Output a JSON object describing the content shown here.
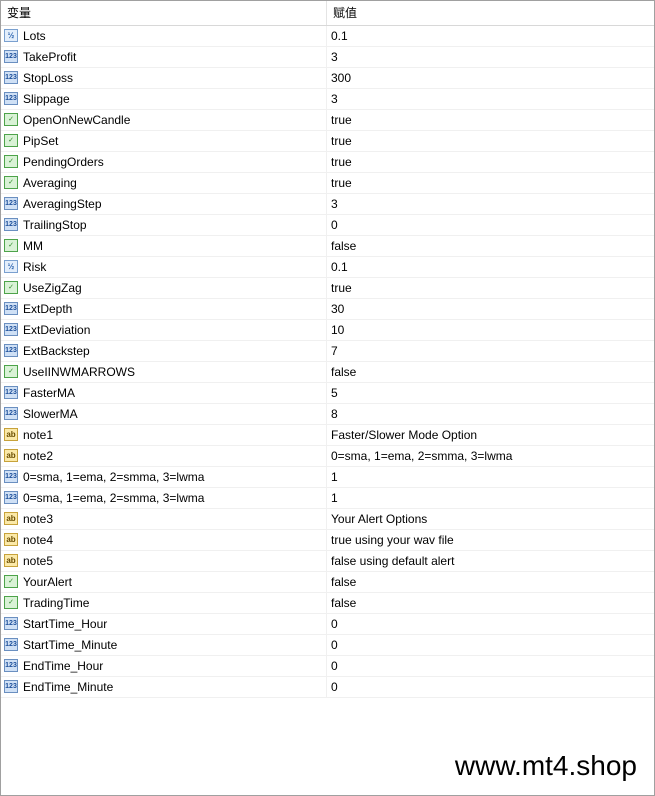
{
  "header": {
    "col_variable": "变量",
    "col_value": "赋值"
  },
  "rows": [
    {
      "name": "Lots",
      "value": "0.1",
      "type": "double",
      "icon": "double-type-icon",
      "badge": "½"
    },
    {
      "name": "TakeProfit",
      "value": "3",
      "type": "int",
      "icon": "int-type-icon",
      "badge": "123"
    },
    {
      "name": "StopLoss",
      "value": "300",
      "type": "int",
      "icon": "int-type-icon",
      "badge": "123"
    },
    {
      "name": "Slippage",
      "value": "3",
      "type": "int",
      "icon": "int-type-icon",
      "badge": "123"
    },
    {
      "name": "OpenOnNewCandle",
      "value": "true",
      "type": "bool",
      "icon": "bool-type-icon",
      "badge": "✓"
    },
    {
      "name": "PipSet",
      "value": "true",
      "type": "bool",
      "icon": "bool-type-icon",
      "badge": "✓"
    },
    {
      "name": "PendingOrders",
      "value": "true",
      "type": "bool",
      "icon": "bool-type-icon",
      "badge": "✓"
    },
    {
      "name": "Averaging",
      "value": "true",
      "type": "bool",
      "icon": "bool-type-icon",
      "badge": "✓"
    },
    {
      "name": "AveragingStep",
      "value": "3",
      "type": "int",
      "icon": "int-type-icon",
      "badge": "123"
    },
    {
      "name": "TrailingStop",
      "value": "0",
      "type": "int",
      "icon": "int-type-icon",
      "badge": "123"
    },
    {
      "name": "MM",
      "value": "false",
      "type": "bool",
      "icon": "bool-type-icon",
      "badge": "✓"
    },
    {
      "name": "Risk",
      "value": "0.1",
      "type": "double",
      "icon": "double-type-icon",
      "badge": "½"
    },
    {
      "name": "UseZigZag",
      "value": "true",
      "type": "bool",
      "icon": "bool-type-icon",
      "badge": "✓"
    },
    {
      "name": "ExtDepth",
      "value": "30",
      "type": "int",
      "icon": "int-type-icon",
      "badge": "123"
    },
    {
      "name": "ExtDeviation",
      "value": "10",
      "type": "int",
      "icon": "int-type-icon",
      "badge": "123"
    },
    {
      "name": "ExtBackstep",
      "value": "7",
      "type": "int",
      "icon": "int-type-icon",
      "badge": "123"
    },
    {
      "name": "UseIINWMARROWS",
      "value": "false",
      "type": "bool",
      "icon": "bool-type-icon",
      "badge": "✓"
    },
    {
      "name": "FasterMA",
      "value": "5",
      "type": "int",
      "icon": "int-type-icon",
      "badge": "123"
    },
    {
      "name": "SlowerMA",
      "value": "8",
      "type": "int",
      "icon": "int-type-icon",
      "badge": "123"
    },
    {
      "name": "note1",
      "value": "Faster/Slower Mode Option",
      "type": "string",
      "icon": "string-type-icon",
      "badge": "ab"
    },
    {
      "name": "note2",
      "value": "0=sma, 1=ema, 2=smma, 3=lwma",
      "type": "string",
      "icon": "string-type-icon",
      "badge": "ab"
    },
    {
      "name": "0=sma, 1=ema, 2=smma, 3=lwma",
      "value": "1",
      "type": "int",
      "icon": "int-type-icon",
      "badge": "123"
    },
    {
      "name": "0=sma, 1=ema, 2=smma, 3=lwma",
      "value": "1",
      "type": "int",
      "icon": "int-type-icon",
      "badge": "123"
    },
    {
      "name": "note3",
      "value": "Your Alert Options",
      "type": "string",
      "icon": "string-type-icon",
      "badge": "ab"
    },
    {
      "name": "note4",
      "value": "true using your wav file",
      "type": "string",
      "icon": "string-type-icon",
      "badge": "ab"
    },
    {
      "name": "note5",
      "value": "false using default alert",
      "type": "string",
      "icon": "string-type-icon",
      "badge": "ab"
    },
    {
      "name": "YourAlert",
      "value": "false",
      "type": "bool",
      "icon": "bool-type-icon",
      "badge": "✓"
    },
    {
      "name": "TradingTime",
      "value": "false",
      "type": "bool",
      "icon": "bool-type-icon",
      "badge": "✓"
    },
    {
      "name": "StartTime_Hour",
      "value": "0",
      "type": "int",
      "icon": "int-type-icon",
      "badge": "123"
    },
    {
      "name": "StartTime_Minute",
      "value": "0",
      "type": "int",
      "icon": "int-type-icon",
      "badge": "123"
    },
    {
      "name": "EndTime_Hour",
      "value": "0",
      "type": "int",
      "icon": "int-type-icon",
      "badge": "123"
    },
    {
      "name": "EndTime_Minute",
      "value": "0",
      "type": "int",
      "icon": "int-type-icon",
      "badge": "123"
    }
  ],
  "watermark": "www.mt4.shop"
}
